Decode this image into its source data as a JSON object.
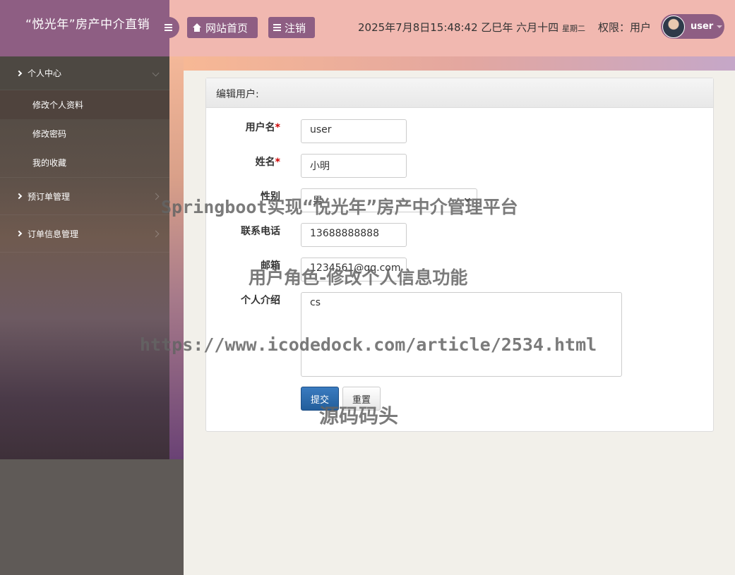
{
  "header": {
    "brand_title": "“悦光年”房产中介直销",
    "home_label": "网站首页",
    "logout_label": "注销",
    "datetime": "2025年7月8日15:48:42 乙巳年 六月十四",
    "weekday": "星期二",
    "permission": "权限：用户",
    "username": "user"
  },
  "sidebar": {
    "groups": [
      {
        "label": "个人中心",
        "items": [
          "修改个人资料",
          "修改密码",
          "我的收藏"
        ]
      },
      {
        "label": "预订单管理"
      },
      {
        "label": "订单信息管理"
      }
    ]
  },
  "form": {
    "title": "编辑用户:",
    "fields": {
      "username": {
        "label": "用户名",
        "value": "user"
      },
      "name": {
        "label": "姓名",
        "value": "小明"
      },
      "gender": {
        "label": "性别",
        "value": "男"
      },
      "phone": {
        "label": "联系电话",
        "value": "13688888888"
      },
      "email": {
        "label": "邮箱",
        "value": "1234561@qq.com"
      },
      "intro": {
        "label": "个人介绍",
        "value": "cs"
      }
    },
    "required_mark": "*",
    "submit_label": "提交",
    "reset_label": "重置"
  },
  "watermarks": {
    "line1": "Springboot实现“悦光年”房产中介管理平台",
    "line2": "用户角色-修改个人信息功能",
    "line3": "https://www.icodedock.com/article/2534.html",
    "line4": "源码码头"
  }
}
